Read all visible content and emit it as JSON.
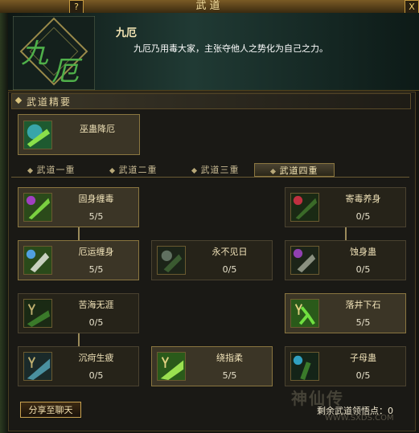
{
  "window": {
    "title": "武道",
    "help": "?",
    "close": "X"
  },
  "header": {
    "name": "九厄",
    "description": "九厄乃用毒大家，主张夺他人之势化为自己之力。",
    "emblem_text": "九厄"
  },
  "section": {
    "title": "武道精要"
  },
  "featured": {
    "name": "巫蛊降厄"
  },
  "tabs": [
    {
      "label": "武道一重"
    },
    {
      "label": "武道二重"
    },
    {
      "label": "武道三重"
    },
    {
      "label": "武道四重"
    }
  ],
  "skills": [
    {
      "name": "固身缠毒",
      "points": "5/5"
    },
    {
      "name": "寄毒养身",
      "points": "0/5"
    },
    {
      "name": "厄运缠身",
      "points": "5/5"
    },
    {
      "name": "永不见日",
      "points": "0/5"
    },
    {
      "name": "蚀身蛊",
      "points": "0/5"
    },
    {
      "name": "苦海无涯",
      "points": "0/5"
    },
    {
      "name": "落井下石",
      "points": "5/5"
    },
    {
      "name": "沉疴生疲",
      "points": "0/5"
    },
    {
      "name": "绕指柔",
      "points": "5/5"
    },
    {
      "name": "子母蛊",
      "points": "0/5"
    }
  ],
  "footer": {
    "share": "分享至聊天",
    "remaining_label": "剩余武道领悟点：",
    "remaining_value": "0"
  },
  "watermark": {
    "brand": "神仙传",
    "url": "WWW.SXDS.COM"
  }
}
